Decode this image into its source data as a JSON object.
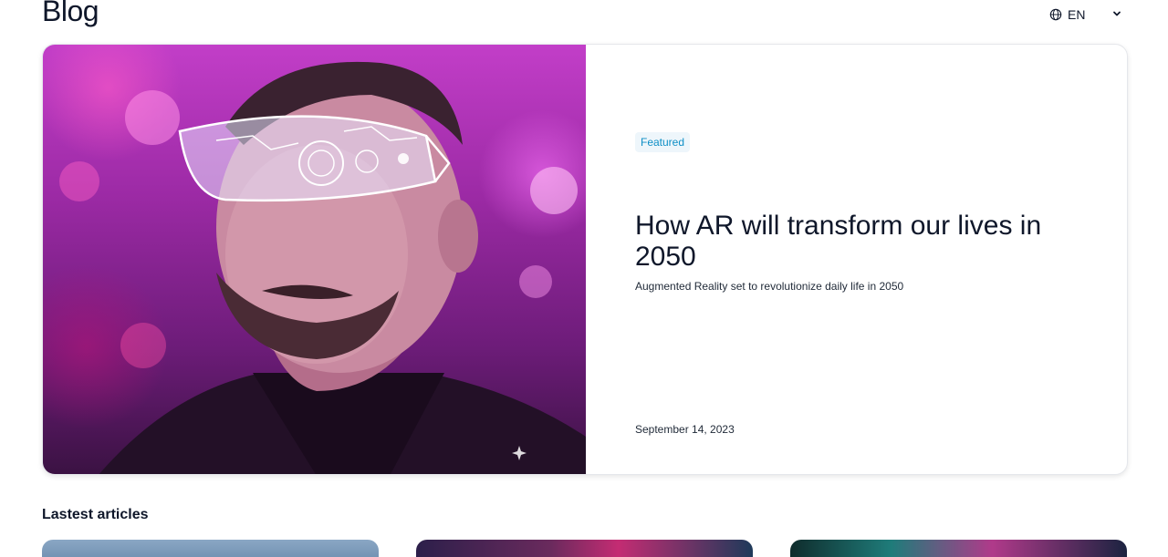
{
  "header": {
    "title": "Blog",
    "language": {
      "label": "EN",
      "icon": "globe-icon",
      "dropdown_icon": "chevron-down-icon"
    }
  },
  "featured": {
    "badge": "Featured",
    "title": "How AR will transform our lives in 2050",
    "subtitle": "Augmented Reality set to revolutionize daily life in 2050",
    "date": "September 14, 2023",
    "image_icon": "ar-glasses-man-image"
  },
  "latest": {
    "title": "Lastest articles",
    "articles": [
      {
        "image": "article-thumbnail-1"
      },
      {
        "image": "article-thumbnail-2"
      },
      {
        "image": "article-thumbnail-3"
      }
    ]
  },
  "colors": {
    "badge_text": "#0e8fc6",
    "badge_bg": "#eef6fb",
    "text_primary": "#0f172a"
  }
}
